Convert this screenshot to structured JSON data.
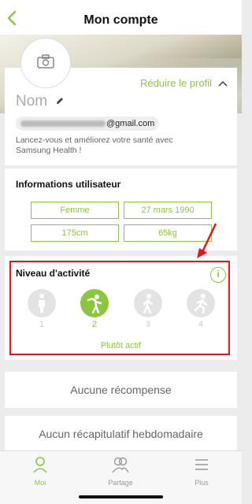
{
  "header": {
    "title": "Mon compte",
    "back_icon": "chevron-left-icon"
  },
  "profile": {
    "reduce_label": "Réduire le profil",
    "name_placeholder": "Nom",
    "email_domain": "@gmail.com",
    "motto": "Lancez-vous et améliorez votre santé avec Samsung Health !"
  },
  "user_info": {
    "title": "Informations utilisateur",
    "gender": "Femme",
    "birthdate": "27 mars 1990",
    "height": "175cm",
    "weight": "65kg"
  },
  "activity": {
    "title": "Niveau d'activité",
    "levels": [
      {
        "number": "1",
        "icon": "standing-person-icon"
      },
      {
        "number": "2",
        "icon": "stretching-person-icon"
      },
      {
        "number": "3",
        "icon": "walking-person-icon"
      },
      {
        "number": "4",
        "icon": "running-person-icon"
      }
    ],
    "selected_level": 2,
    "selected_label": "Plutôt actif"
  },
  "rewards": {
    "label": "Aucune récompense"
  },
  "weekly": {
    "label": "Aucun récapitulatif hebdomadaire"
  },
  "tabs": [
    {
      "label": "Moi",
      "icon": "person-icon",
      "active": true
    },
    {
      "label": "Partage",
      "icon": "people-icon",
      "active": false
    },
    {
      "label": "Plus",
      "icon": "menu-icon",
      "active": false
    }
  ],
  "colors": {
    "accent": "#8cc63f",
    "annotation": "#e8141d"
  }
}
